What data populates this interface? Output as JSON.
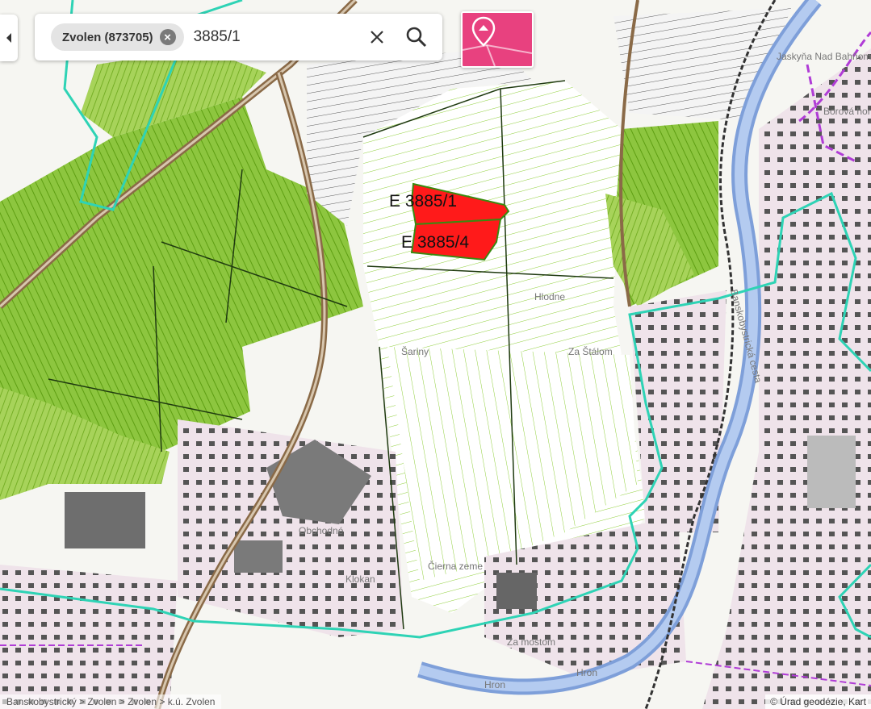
{
  "search": {
    "chip_label": "Zvolen (873705)",
    "query": "3885/1"
  },
  "parcels": [
    {
      "label": "E 3885/1"
    },
    {
      "label": "E 3885/4"
    }
  ],
  "places": [
    "Hlodne",
    "Šariny",
    "Za Štálom",
    "Čierna zeme",
    "Za mostom",
    "Hron",
    "Hron",
    "Banskobystrická cesta",
    "Borová hora",
    "Jaskyňa Nad Bahňom",
    "Obchodné",
    "Klokan"
  ],
  "breadcrumb": "Banskobystrický > Zvolen > Zvolen > k.ú. Zvolen",
  "attribution": "© Úrad geodézie, Kart",
  "colors": {
    "vineyard": "#7fbf1a",
    "parcel_highlight": "#ff1a1a",
    "boundary": "#2ed3b5",
    "river": "#9bb8e8",
    "poi_button": "#e8417f"
  }
}
